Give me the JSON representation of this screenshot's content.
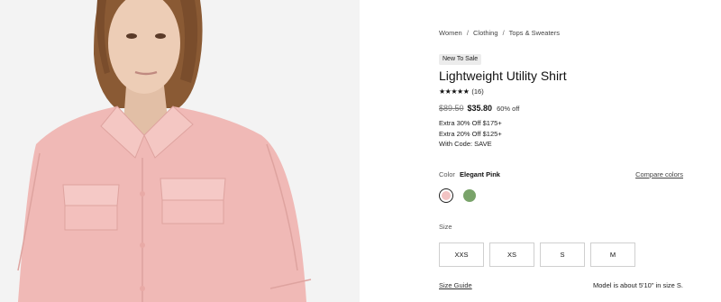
{
  "breadcrumb": {
    "items": [
      "Women",
      "Clothing",
      "Tops & Sweaters"
    ],
    "separator": "/"
  },
  "product": {
    "badge": "New To Sale",
    "title": "Lightweight Utility Shirt",
    "rating": {
      "stars": "★★★★★",
      "value": 5,
      "count_label": "(16)"
    },
    "price": {
      "original": "$89.50",
      "sale": "$35.80",
      "discount": "60% off"
    },
    "promos": [
      "Extra 30% Off $175+",
      "Extra 20% Off $125+",
      "With Code: SAVE"
    ],
    "image_alt": "Model wearing pink utility shirt"
  },
  "color": {
    "label": "Color",
    "selected": "Elegant Pink",
    "compare_link": "Compare colors",
    "swatches": [
      {
        "name": "Elegant Pink",
        "hex": "#f2c3c3",
        "selected": true
      },
      {
        "name": "Green",
        "hex": "#79a36a",
        "selected": false
      }
    ]
  },
  "size": {
    "label": "Size",
    "options": [
      "XXS",
      "XS",
      "S",
      "M"
    ],
    "guide_link": "Size Guide",
    "model_info": "Model is about 5'10\" in size S."
  },
  "colors": {
    "shirt": "#f0b9b6",
    "background": "#f3f3f3",
    "text": "#1a1a1a"
  }
}
